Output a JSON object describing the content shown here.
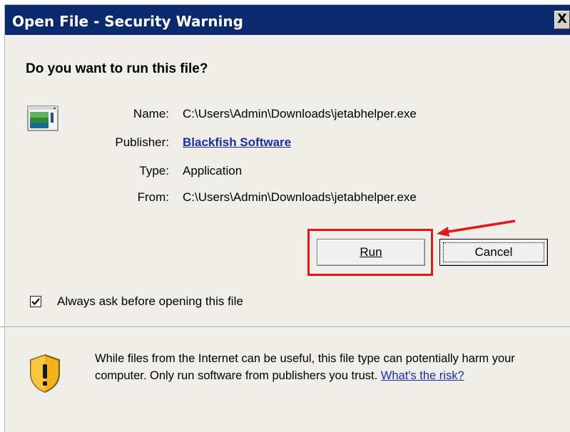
{
  "window": {
    "title": "Open File - Security Warning",
    "close_label": "X"
  },
  "question": "Do you want to run this file?",
  "fields": [
    {
      "label": "Name:",
      "value": "C:\\Users\\Admin\\Downloads\\jetabhelper.exe"
    },
    {
      "label": "Publisher:",
      "value": "Blackfish Software"
    },
    {
      "label": "Type:",
      "value": "Application"
    },
    {
      "label": "From:",
      "value": "C:\\Users\\Admin\\Downloads\\jetabhelper.exe"
    }
  ],
  "buttons": {
    "run_label": "Run",
    "cancel_label": "Cancel"
  },
  "checkbox": {
    "label": "Always ask before opening this file",
    "checked": true
  },
  "warning": {
    "text": "While files from the Internet can be useful, this file type can potentially harm your computer. Only run software from publishers you trust.",
    "link": "What's the risk?"
  },
  "icons": {
    "app": "application-icon",
    "shield": "warning-shield-icon",
    "close": "close-icon"
  },
  "colors": {
    "titlebar": "#0b2a6e",
    "link": "#1a2ea3",
    "highlight": "#e31919"
  }
}
